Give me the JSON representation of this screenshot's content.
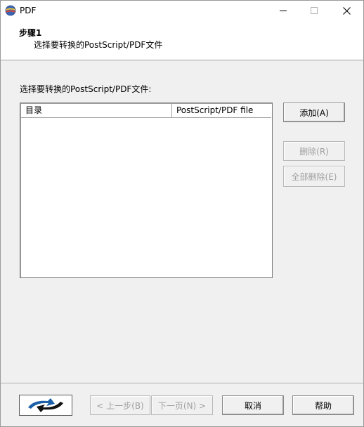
{
  "window": {
    "title": "PDF"
  },
  "header": {
    "step_title": "步骤1",
    "step_desc": "选择要转换的PostScript/PDF文件"
  },
  "main": {
    "list_label": "选择要转换的PostScript/PDF文件:",
    "columns": [
      "目录",
      "PostScript/PDF file"
    ],
    "rows": []
  },
  "side_buttons": {
    "add": "添加(A)",
    "delete": "删除(R)",
    "delete_all": "全部删除(E)"
  },
  "footer": {
    "back": "< 上一步(B)",
    "next": "下一页(N) >",
    "cancel": "取消",
    "help": "帮助"
  },
  "icons": {
    "app": "pdf-app-icon",
    "minimize": "minimize-icon",
    "maximize": "maximize-icon",
    "close": "close-icon",
    "logo": "sync-arrows-logo-icon"
  },
  "colors": {
    "window_bg": "#f0f0f0",
    "header_bg": "#ffffff",
    "disabled_text": "#a0a0a0"
  }
}
